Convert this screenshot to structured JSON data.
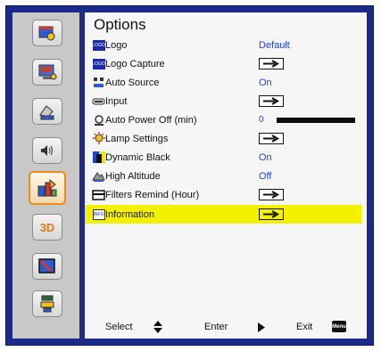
{
  "menu": {
    "title": "Options"
  },
  "sidebar": {
    "items": [
      {
        "name": "image",
        "icon": "picture-settings-icon"
      },
      {
        "name": "display",
        "icon": "display-settings-icon"
      },
      {
        "name": "setup",
        "icon": "setup-icon"
      },
      {
        "name": "audio",
        "icon": "volume-icon"
      },
      {
        "name": "options",
        "icon": "options-icon",
        "active": true
      },
      {
        "name": "3d",
        "icon": "3d-icon",
        "label": "3D"
      },
      {
        "name": "settings",
        "icon": "interactive-icon"
      },
      {
        "name": "network",
        "icon": "network-icon"
      }
    ]
  },
  "options": {
    "items": [
      {
        "icon": "logo-icon",
        "icon_text": "LOGO",
        "label": "Logo",
        "value": "Default"
      },
      {
        "icon": "logo-capture-icon",
        "icon_text": "LOGO",
        "label": "Logo Capture",
        "value": ""
      },
      {
        "icon": "auto-source-icon",
        "label": "Auto Source",
        "value": "On"
      },
      {
        "icon": "input-icon",
        "label": "Input",
        "value": ""
      },
      {
        "icon": "auto-power-off-icon",
        "label": "Auto Power Off (min)",
        "value": "0"
      },
      {
        "icon": "lamp-settings-icon",
        "label": "Lamp Settings",
        "value": ""
      },
      {
        "icon": "dynamic-black-icon",
        "label": "Dynamic Black",
        "value": "On"
      },
      {
        "icon": "high-altitude-icon",
        "label": "High Altitude",
        "value": "Off"
      },
      {
        "icon": "filter-icon",
        "label": "Filters Remind (Hour)",
        "value": ""
      },
      {
        "icon": "information-icon",
        "icon_text": "INFO",
        "label": "Information",
        "value": ""
      }
    ],
    "selected_index": 9,
    "auto_power_off_level": 0
  },
  "footer": {
    "select_label": "Select",
    "enter_label": "Enter",
    "exit_label": "Exit",
    "menu_key": "Menu"
  },
  "colors": {
    "frame": "#1c2a8a",
    "highlight": "#f4f100",
    "value_text": "#1a44d8",
    "active_border": "#f08a1c"
  }
}
